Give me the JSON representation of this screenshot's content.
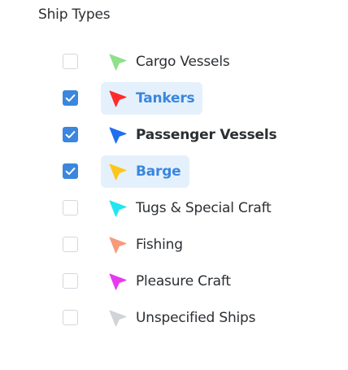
{
  "section": {
    "title": "Ship Types"
  },
  "ship_types": [
    {
      "label": "Cargo Vessels",
      "checked": false,
      "icon": "navigation-arrow-icon",
      "color": "#8fe08a",
      "style": "normal"
    },
    {
      "label": "Tankers",
      "checked": true,
      "icon": "navigation-arrow-icon",
      "color": "#ff2b2b",
      "style": "highlight"
    },
    {
      "label": "Passenger Vessels",
      "checked": true,
      "icon": "navigation-arrow-icon",
      "color": "#1f6ff0",
      "style": "bold"
    },
    {
      "label": "Barge",
      "checked": true,
      "icon": "navigation-arrow-icon",
      "color": "#ffc61a",
      "style": "highlight"
    },
    {
      "label": "Tugs & Special Craft",
      "checked": false,
      "icon": "navigation-arrow-icon",
      "color": "#22e5f0",
      "style": "normal"
    },
    {
      "label": "Fishing",
      "checked": false,
      "icon": "navigation-arrow-icon",
      "color": "#f79a7c",
      "style": "normal"
    },
    {
      "label": "Pleasure Craft",
      "checked": false,
      "icon": "navigation-arrow-icon",
      "color": "#e63af0",
      "style": "normal"
    },
    {
      "label": "Unspecified Ships",
      "checked": false,
      "icon": "navigation-arrow-icon",
      "color": "#d0d3d7",
      "style": "normal"
    }
  ],
  "colors": {
    "accent": "#3b86de",
    "highlight_bg": "#e4f1fc",
    "checkbox_border": "#d3d7dc",
    "text": "#2b2f33"
  }
}
